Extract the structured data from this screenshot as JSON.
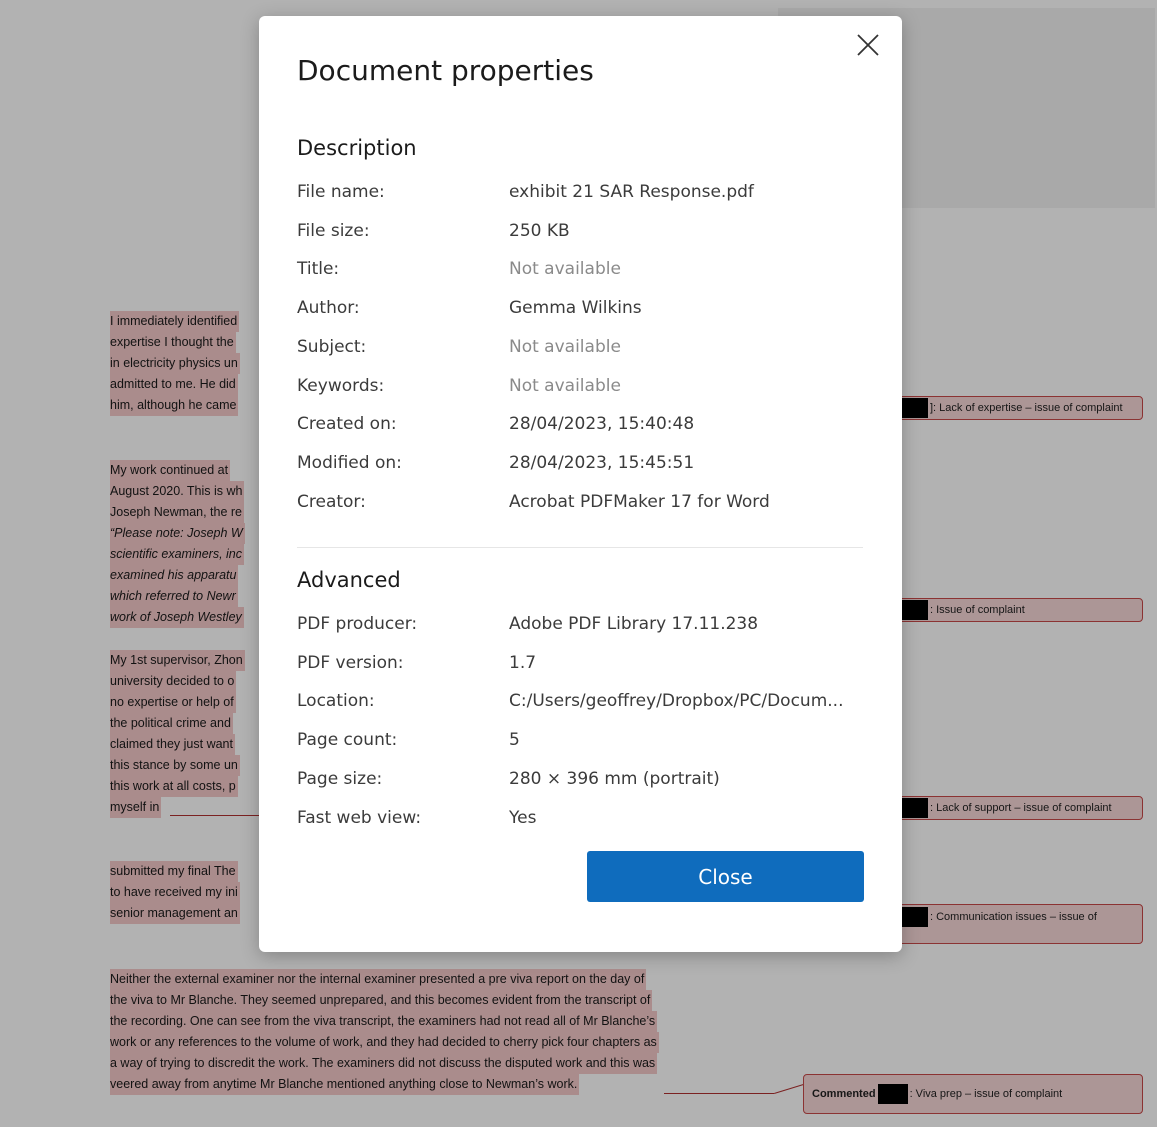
{
  "background": {
    "paragraphs": [
      {
        "lines": [
          "I immediately identified",
          "expertise I thought the",
          "in electricity physics un",
          "admitted to me. He did",
          "him, although he came"
        ]
      },
      {
        "lines": [
          "My work continued at",
          "August 2020. This is wh",
          "Joseph Newman, the re",
          "“Please note: Joseph W",
          "scientific examiners, inc",
          "examined his apparatu",
          "which referred to Newr",
          "work of Joseph Westley"
        ]
      },
      {
        "lines": [
          "My 1st supervisor, Zhon",
          "university decided to o",
          "no expertise or help of",
          "the political crime and",
          "claimed they just want",
          "this stance by some un",
          "this work at all costs, p",
          "myself in"
        ]
      },
      {
        "lines": [
          "submitted my final The",
          "to have received my ini",
          "senior management an"
        ]
      },
      {
        "lines": [
          "Neither the external examiner nor the internal examiner presented a pre viva report on the day of",
          "the viva to Mr Blanche. They seemed unprepared, and this becomes evident from the transcript of",
          "the recording. One can see from the viva transcript, the examiners had not read all of Mr Blanche’s",
          "work or any references to the volume of work, and they had decided to cherry pick four chapters as",
          "a way of trying to discredit the work. The examiners did not discuss the disputed work and this was",
          "veered away from anytime Mr Blanche mentioned anything close to Newman’s work."
        ]
      }
    ],
    "comments": [
      {
        "author": "",
        "text": "]: Lack of expertise – issue of complaint"
      },
      {
        "author": "",
        "text": ": Issue of complaint"
      },
      {
        "author": "",
        "text": ": Lack of support – issue of complaint"
      },
      {
        "author": "",
        "text": ": Communication issues – issue of"
      },
      {
        "author": "Commented",
        "text": ": Viva prep – issue of complaint"
      }
    ]
  },
  "dialog": {
    "title": "Document properties",
    "close_icon": "close-icon",
    "description_heading": "Description",
    "description_rows": [
      {
        "label": "File name:",
        "value": "exhibit 21 SAR Response.pdf",
        "na": false
      },
      {
        "label": "File size:",
        "value": "250 KB",
        "na": false
      },
      {
        "label": "Title:",
        "value": "Not available",
        "na": true
      },
      {
        "label": "Author:",
        "value": "Gemma Wilkins",
        "na": false
      },
      {
        "label": "Subject:",
        "value": "Not available",
        "na": true
      },
      {
        "label": "Keywords:",
        "value": "Not available",
        "na": true
      },
      {
        "label": "Created on:",
        "value": "28/04/2023, 15:40:48",
        "na": false
      },
      {
        "label": "Modified on:",
        "value": "28/04/2023, 15:45:51",
        "na": false
      },
      {
        "label": "Creator:",
        "value": "Acrobat PDFMaker 17 for Word",
        "na": false
      }
    ],
    "advanced_heading": "Advanced",
    "advanced_rows": [
      {
        "label": "PDF producer:",
        "value": "Adobe PDF Library 17.11.238",
        "na": false
      },
      {
        "label": "PDF version:",
        "value": "1.7",
        "na": false
      },
      {
        "label": "Location:",
        "value": "C:/Users/geoffrey/Dropbox/PC/Docum...",
        "na": false
      },
      {
        "label": "Page count:",
        "value": "5",
        "na": false
      },
      {
        "label": "Page size:",
        "value": "280 × 396 mm (portrait)",
        "na": false
      },
      {
        "label": "Fast web view:",
        "value": "Yes",
        "na": false
      }
    ],
    "close_button_label": "Close",
    "accent_color": "#0f6cbd"
  }
}
